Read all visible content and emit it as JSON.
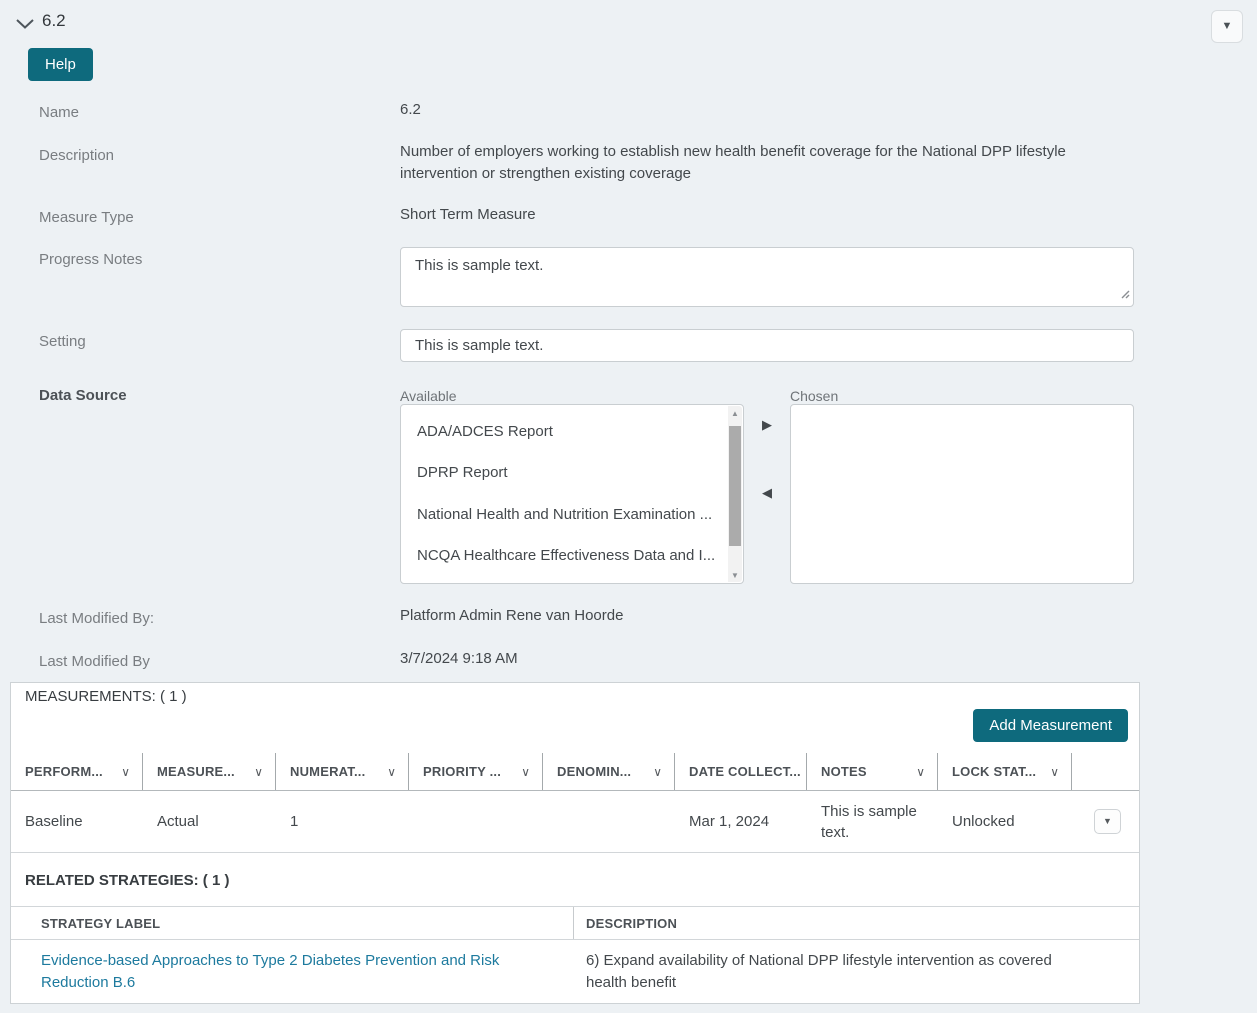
{
  "header": {
    "title": "6.2",
    "help_label": "Help"
  },
  "icons": {
    "sort_chevron": "∨",
    "caret_down": "▼",
    "caret_up": "▲",
    "arrow_right": "▶",
    "arrow_left": "◀"
  },
  "fields": {
    "name": {
      "label": "Name",
      "value": "6.2"
    },
    "description": {
      "label": "Description",
      "value": "Number of employers working to establish new health benefit coverage for the National DPP lifestyle intervention or strengthen existing coverage"
    },
    "measure_type": {
      "label": "Measure Type",
      "value": "Short Term Measure"
    },
    "progress_notes": {
      "label": "Progress Notes",
      "value": "This is sample text."
    },
    "setting": {
      "label": "Setting",
      "value": "This is sample text."
    },
    "data_source": {
      "label": "Data Source",
      "available_label": "Available",
      "chosen_label": "Chosen",
      "available_options": [
        "ADA/ADCES Report",
        "DPRP Report",
        "National Health and Nutrition Examination ...",
        "NCQA Healthcare Effectiveness Data and I..."
      ]
    },
    "last_modified_by_name": {
      "label": "Last Modified By:",
      "value": "Platform Admin Rene van Hoorde"
    },
    "last_modified_by_date": {
      "label": "Last Modified By",
      "value": "3/7/2024 9:18 AM"
    }
  },
  "measurements": {
    "title": "MEASUREMENTS: ( 1 )",
    "add_button_label": "Add Measurement",
    "columns": [
      {
        "label": "PERFORM..."
      },
      {
        "label": "MEASURE..."
      },
      {
        "label": "NUMERAT..."
      },
      {
        "label": "PRIORITY ..."
      },
      {
        "label": "DENOMIN..."
      },
      {
        "label": "DATE COLLECT..."
      },
      {
        "label": "NOTES"
      },
      {
        "label": "LOCK STAT..."
      }
    ],
    "row": {
      "performance": "Baseline",
      "measure": "Actual",
      "numerator": "1",
      "priority": "",
      "denominator": "",
      "date_collected": "Mar 1, 2024",
      "notes": "This is sample text.",
      "lock_status": "Unlocked"
    }
  },
  "related_strategies": {
    "title": "RELATED STRATEGIES: ( 1 )",
    "strategy_label_header": "STRATEGY LABEL",
    "description_header": "DESCRIPTION",
    "row": {
      "label": "Evidence-based Approaches to Type 2 Diabetes Prevention and Risk Reduction B.6",
      "description": "6) Expand availability of National DPP lifestyle intervention as covered health benefit"
    }
  },
  "colors": {
    "accent_teal": "#0e6a7d",
    "link": "#1d7a9e",
    "page_bg": "#edf1f4"
  }
}
